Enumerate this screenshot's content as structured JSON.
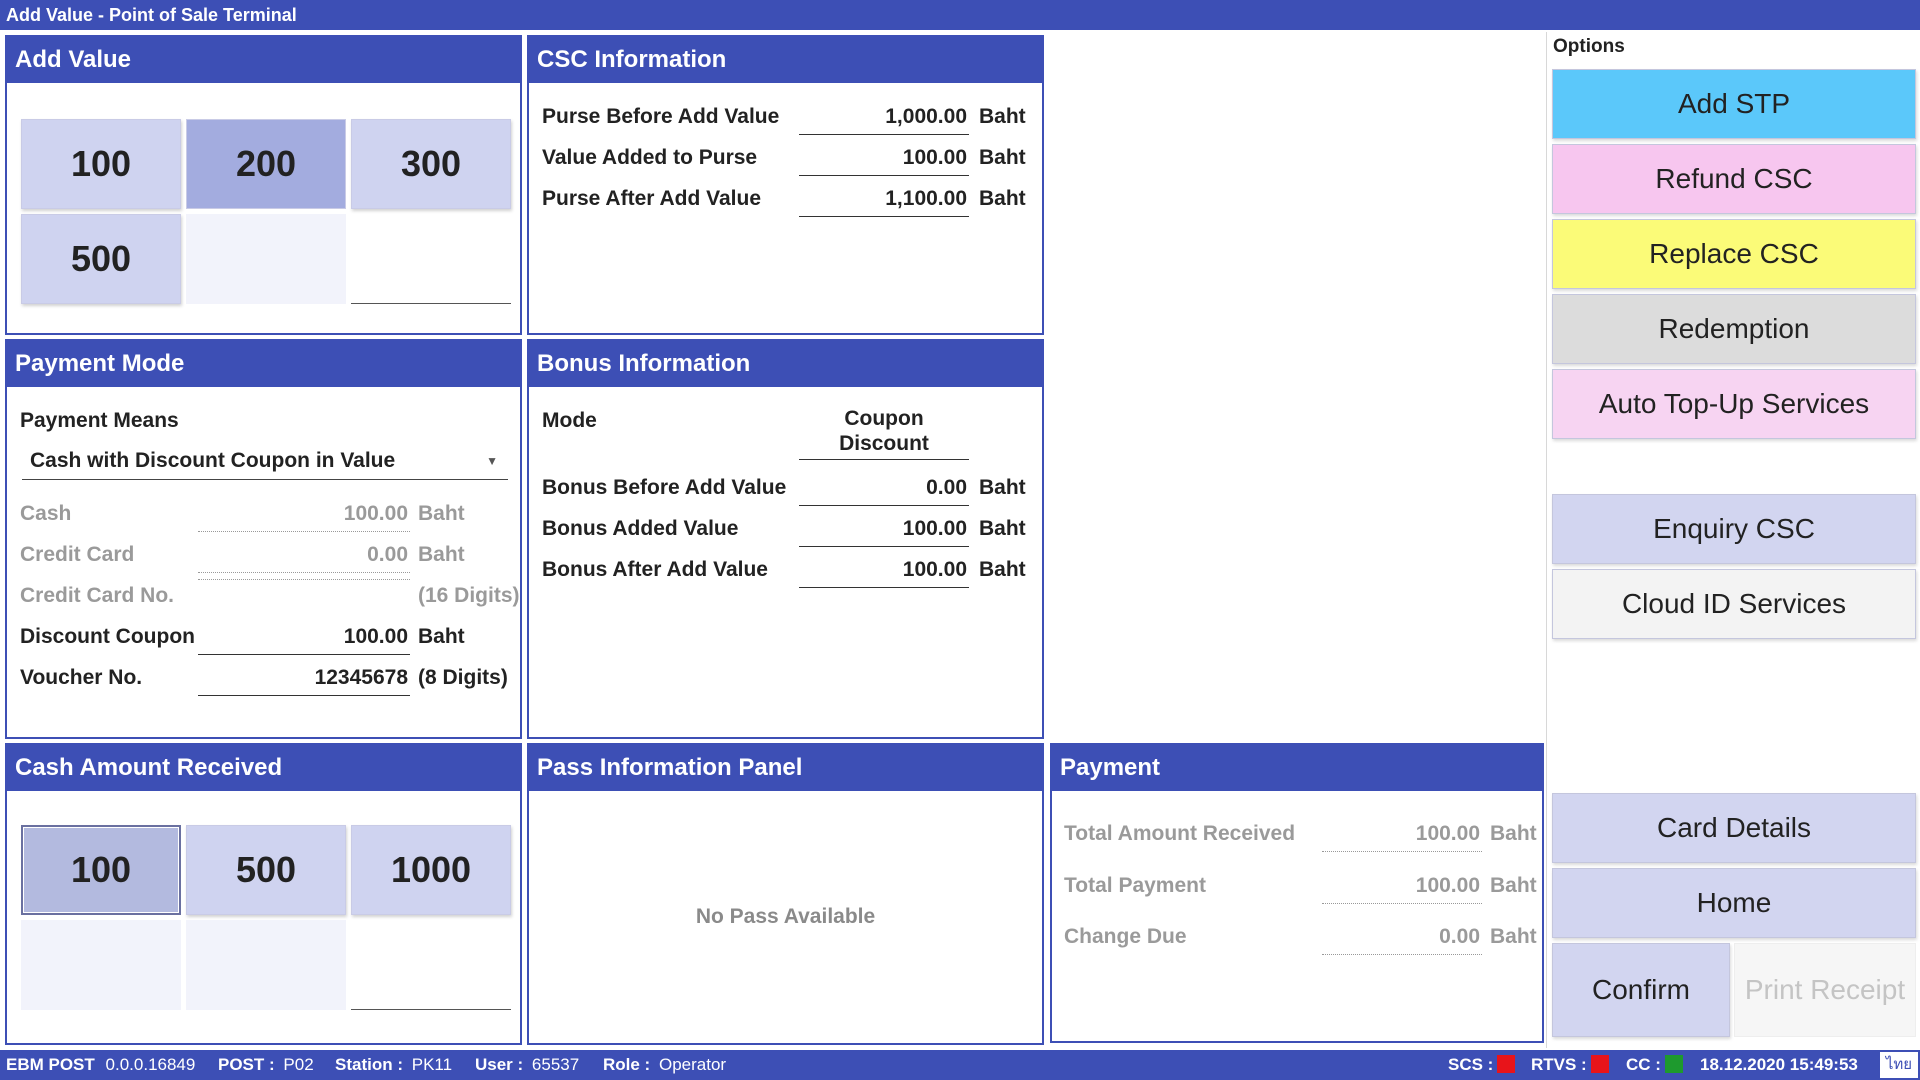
{
  "window": {
    "title": "Add Value - Point of Sale Terminal"
  },
  "add_value": {
    "title": "Add Value",
    "tiles": [
      "100",
      "200",
      "300",
      "500"
    ]
  },
  "csc_info": {
    "title": "CSC Information",
    "rows": [
      {
        "label": "Purse Before Add Value",
        "value": "1,000.00",
        "unit": "Baht"
      },
      {
        "label": "Value Added to Purse",
        "value": "100.00",
        "unit": "Baht"
      },
      {
        "label": "Purse After Add Value",
        "value": "1,100.00",
        "unit": "Baht"
      }
    ]
  },
  "payment_mode": {
    "title": "Payment Mode",
    "means_label": "Payment Means",
    "means_value": "Cash with Discount Coupon in Value",
    "rows": [
      {
        "label": "Cash",
        "value": "100.00",
        "unit": "Baht"
      },
      {
        "label": "Credit Card",
        "value": "0.00",
        "unit": "Baht"
      },
      {
        "label": "Credit Card No.",
        "value": "",
        "unit": "(16 Digits)"
      },
      {
        "label": "Discount Coupon",
        "value": "100.00",
        "unit": "Baht"
      },
      {
        "label": "Voucher No.",
        "value": "12345678",
        "unit": "(8 Digits)"
      }
    ]
  },
  "bonus_info": {
    "title": "Bonus Information",
    "mode_label": "Mode",
    "mode_value_line1": "Coupon",
    "mode_value_line2": "Discount",
    "rows": [
      {
        "label": "Bonus Before Add Value",
        "value": "0.00",
        "unit": "Baht"
      },
      {
        "label": "Bonus Added Value",
        "value": "100.00",
        "unit": "Baht"
      },
      {
        "label": "Bonus After Add Value",
        "value": "100.00",
        "unit": "Baht"
      }
    ]
  },
  "cash_received": {
    "title": "Cash Amount Received",
    "tiles": [
      "100",
      "500",
      "1000"
    ]
  },
  "pass_info": {
    "title": "Pass Information Panel",
    "message": "No Pass Available"
  },
  "payment": {
    "title": "Payment",
    "rows": [
      {
        "label": "Total Amount Received",
        "value": "100.00",
        "unit": "Baht"
      },
      {
        "label": "Total Payment",
        "value": "100.00",
        "unit": "Baht"
      },
      {
        "label": "Change Due",
        "value": "0.00",
        "unit": "Baht"
      }
    ]
  },
  "options": {
    "title": "Options",
    "buttons": [
      "Add STP",
      "Refund CSC",
      "Replace CSC",
      "Redemption",
      "Auto Top-Up Services",
      "Enquiry CSC",
      "Cloud ID Services"
    ],
    "colors": [
      "#5bc8fa",
      "#f7c6ef",
      "#fbfb78",
      "#dcdcdc",
      "#f7d4f2",
      "#d2d5f0",
      "#f3f3f3"
    ]
  },
  "actions": {
    "card_details": "Card Details",
    "home": "Home",
    "confirm": "Confirm",
    "print_receipt": "Print Receipt"
  },
  "status": {
    "app_label": "EBM POST",
    "version": "0.0.0.16849",
    "post_label": "POST :",
    "post_value": "P02",
    "station_label": "Station :",
    "station_value": "PK11",
    "user_label": "User :",
    "user_value": "65537",
    "role_label": "Role :",
    "role_value": "Operator",
    "scs_label": "SCS :",
    "rtvs_label": "RTVS :",
    "cc_label": "CC :",
    "scs_color": "#e8141a",
    "rtvs_color": "#e8141a",
    "cc_color": "#1e9a2e",
    "datetime": "18.12.2020 15:49:53",
    "lang": "ไทย"
  }
}
